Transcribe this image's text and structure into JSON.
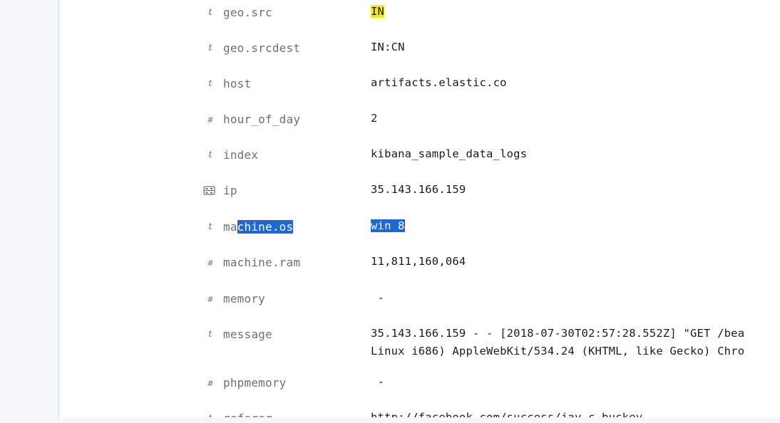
{
  "fields": [
    {
      "type_icon": "t",
      "name": "geo.src",
      "value": "IN"
    },
    {
      "type_icon": "t",
      "name": "geo.srcdest",
      "value": "IN:CN"
    },
    {
      "type_icon": "t",
      "name": "host",
      "value": "artifacts.elastic.co"
    },
    {
      "type_icon": "#",
      "name": "hour_of_day",
      "value": "2"
    },
    {
      "type_icon": "t",
      "name": "index",
      "value": "kibana_sample_data_logs"
    },
    {
      "type_icon": "ip",
      "name": "ip",
      "value": "35.143.166.159"
    },
    {
      "type_icon": "t",
      "name_prefix": "ma",
      "name_selected": "chine.os",
      "value": "win 8"
    },
    {
      "type_icon": "#",
      "name": "machine.ram",
      "value": "11,811,160,064"
    },
    {
      "type_icon": "#",
      "name": "memory",
      "value": " -"
    },
    {
      "type_icon": "t",
      "name": "message",
      "value_line1": "35.143.166.159 - - [2018-07-30T02:57:28.552Z] \"GET /bea",
      "value_line2": "Linux i686) AppleWebKit/534.24 (KHTML, like Gecko) Chro"
    },
    {
      "type_icon": "#",
      "name": "phpmemory",
      "value": " -"
    },
    {
      "type_icon": "t",
      "name": "referer",
      "value": "http://facebook.com/success/jay-c-buckey"
    }
  ]
}
